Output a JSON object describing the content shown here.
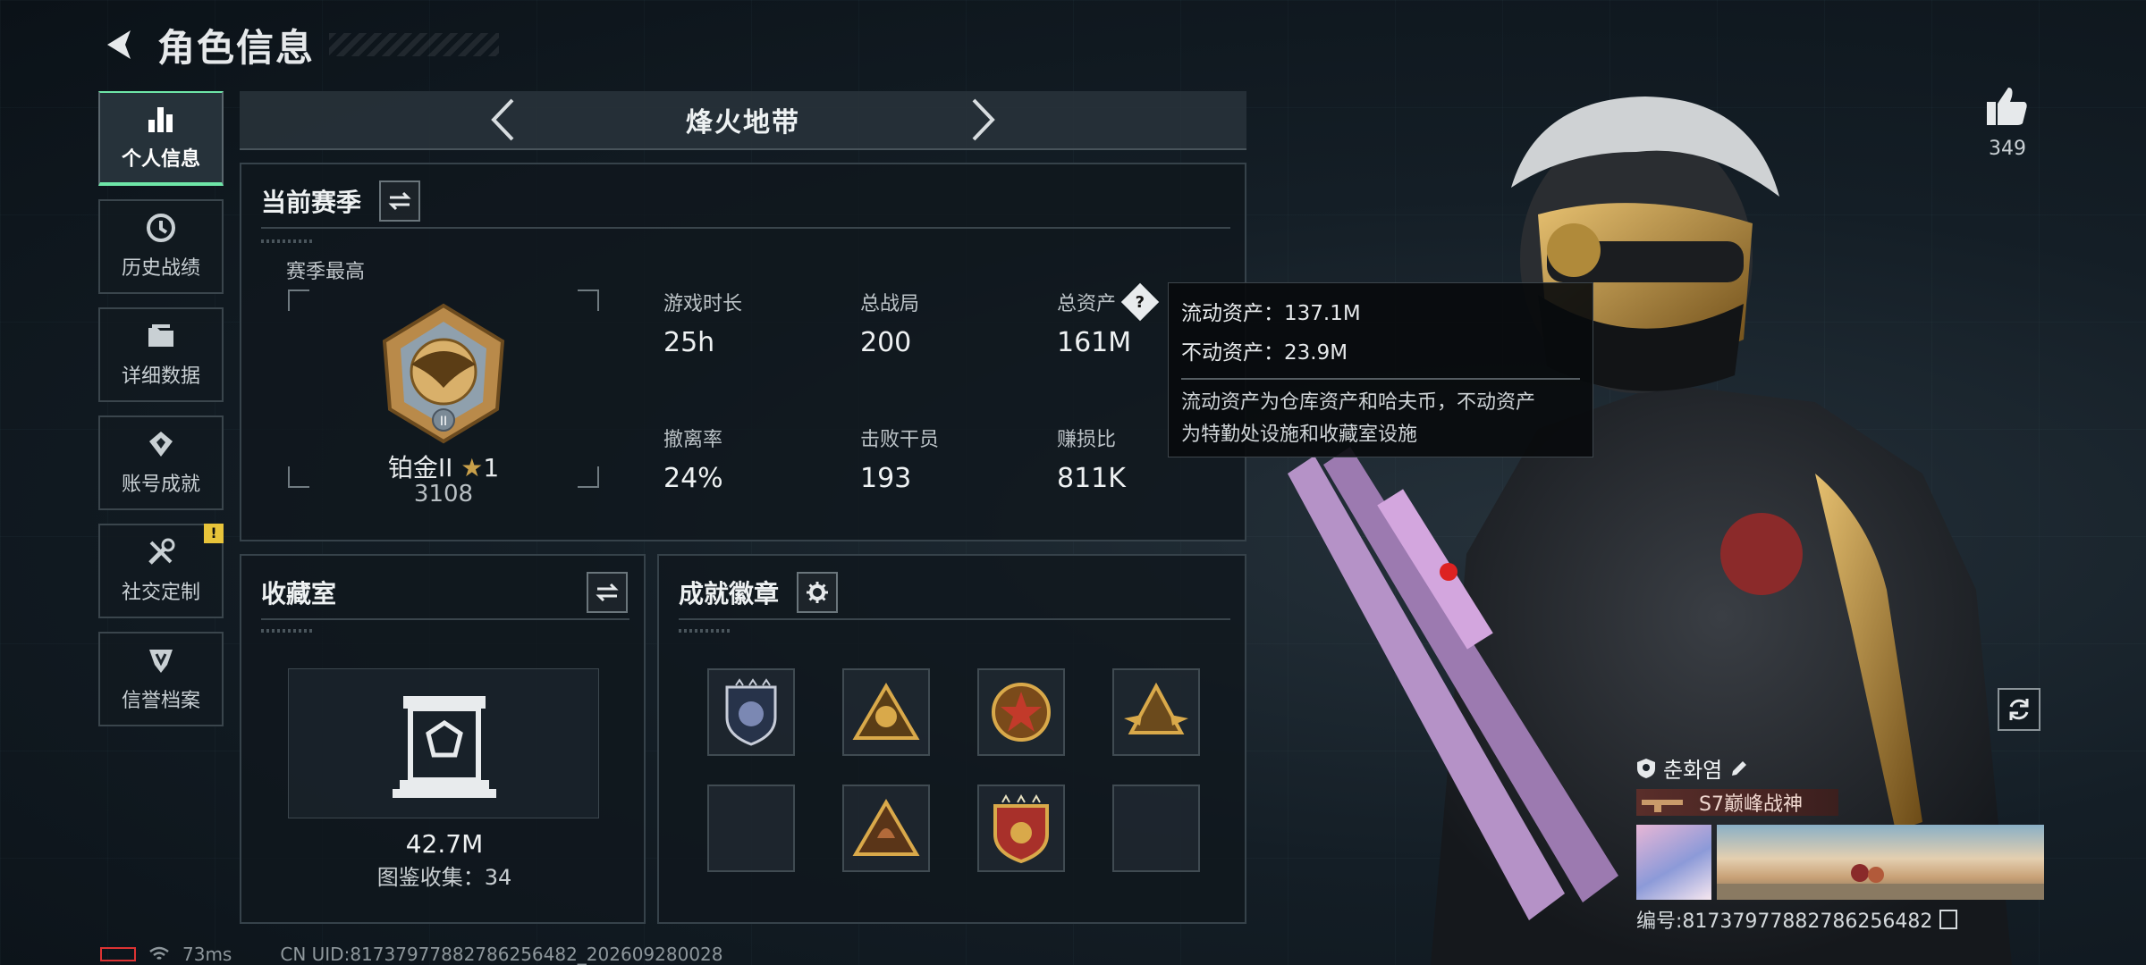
{
  "header": {
    "title": "角色信息"
  },
  "sidebar": {
    "items": [
      {
        "label": "个人信息",
        "icon": "bar-chart-icon",
        "active": true
      },
      {
        "label": "历史战绩",
        "icon": "history-clock-icon"
      },
      {
        "label": "详细数据",
        "icon": "folder-icon"
      },
      {
        "label": "账号成就",
        "icon": "achievement-icon"
      },
      {
        "label": "社交定制",
        "icon": "tools-icon",
        "badge": "!"
      },
      {
        "label": "信誉档案",
        "icon": "credit-shield-icon"
      }
    ]
  },
  "mode": {
    "title": "烽火地带"
  },
  "season": {
    "title": "当前赛季",
    "best_label": "赛季最高",
    "rank_name": "铂金II",
    "rank_stars": "1",
    "rank_score": "3108",
    "stats": [
      {
        "label": "游戏时长",
        "value": "25h"
      },
      {
        "label": "总战局",
        "value": "200"
      },
      {
        "label": "总资产",
        "value": "161M"
      },
      {
        "label": "撤离率",
        "value": "24%"
      },
      {
        "label": "击败干员",
        "value": "193"
      },
      {
        "label": "赚损比",
        "value": "811K"
      }
    ]
  },
  "tooltip": {
    "line1": "流动资产：137.1M",
    "line2": "不动资产：23.9M",
    "note1": "流动资产为仓库资产和哈夫币，不动资产",
    "note2": "为特勤处设施和收藏室设施"
  },
  "collection": {
    "title": "收藏室",
    "value": "42.7M",
    "sub": "图鉴收集：34"
  },
  "badges": {
    "title": "成就徽章"
  },
  "likes": {
    "count": "349"
  },
  "player": {
    "name": "춘화염",
    "title": "S7巅峰战神",
    "id": "编号:81737977882786256482"
  },
  "status": {
    "ping": "73ms",
    "uid": "CN UID:81737977882786256482_202609280028"
  },
  "colors": {
    "accent": "#6ee6a8",
    "warning": "#e8c43a",
    "gold": "#c9a04a"
  }
}
